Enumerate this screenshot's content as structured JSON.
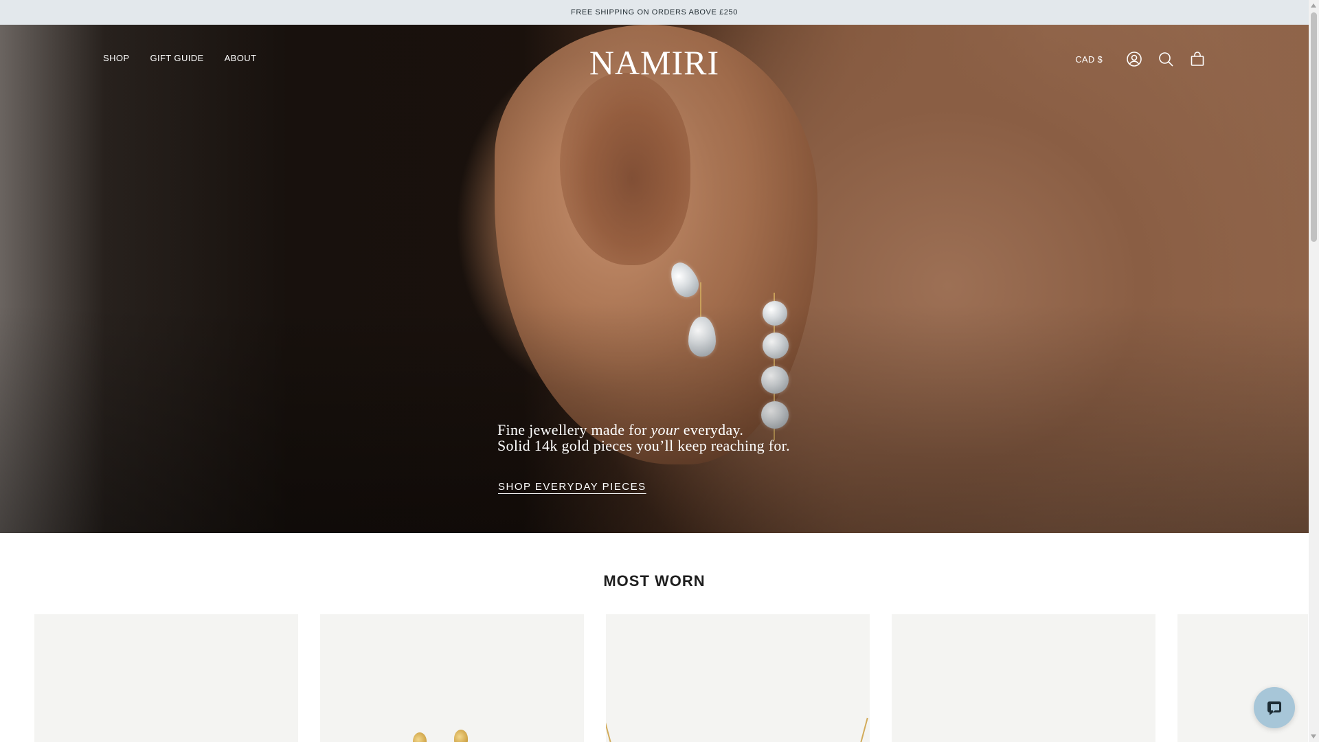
{
  "announcement": {
    "text": "FREE SHIPPING ON ORDERS ABOVE £250"
  },
  "header": {
    "nav": [
      {
        "label": "SHOP"
      },
      {
        "label": "GIFT GUIDE"
      },
      {
        "label": "ABOUT"
      }
    ],
    "logo": "NAMIRI",
    "currency": "CAD $",
    "icons": [
      "account-icon",
      "search-icon",
      "cart-icon"
    ]
  },
  "hero": {
    "line1_before": "Fine jewellery made for ",
    "line1_emphasis": "your",
    "line1_after": " everyday.",
    "line2": "Solid 14k gold pieces you’ll keep reaching for.",
    "cta": "SHOP EVERYDAY PIECES"
  },
  "most_worn": {
    "title": "MOST WORN",
    "product_count_visible": 5
  },
  "chat": {
    "icon": "chat-icon",
    "accent": "#a7c6d8"
  },
  "colors": {
    "announcement_bg": "#e3e8ec",
    "card_bg": "#f4f4f2",
    "text_dark": "#1a1a1a"
  }
}
